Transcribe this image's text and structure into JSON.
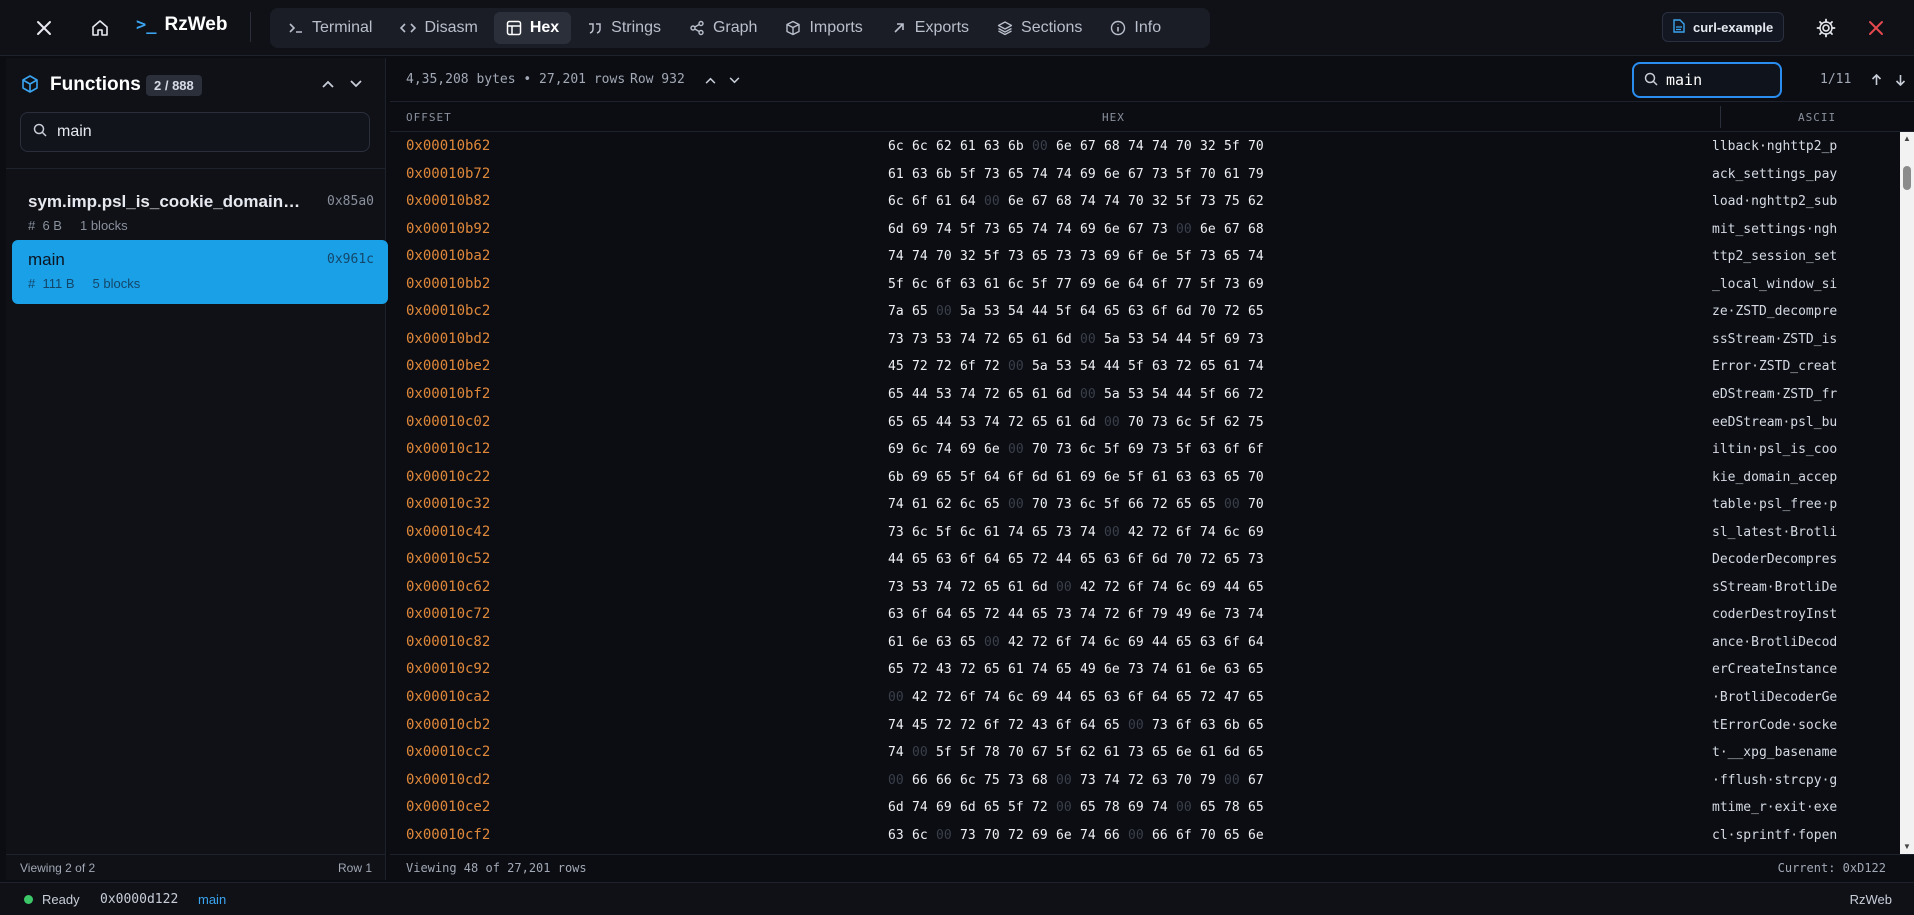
{
  "topbar": {
    "brand": "RzWeb",
    "brand_prompt": ">_",
    "tabs": [
      {
        "label": "Terminal",
        "icon": "terminal-icon",
        "active": false
      },
      {
        "label": "Disasm",
        "icon": "code-icon",
        "active": false
      },
      {
        "label": "Hex",
        "icon": "table-icon",
        "active": true
      },
      {
        "label": "Strings",
        "icon": "quote-icon",
        "active": false
      },
      {
        "label": "Graph",
        "icon": "share-icon",
        "active": false
      },
      {
        "label": "Imports",
        "icon": "package-icon",
        "active": false
      },
      {
        "label": "Exports",
        "icon": "arrow-up-right-icon",
        "active": false
      },
      {
        "label": "Sections",
        "icon": "layers-icon",
        "active": false
      },
      {
        "label": "Info",
        "icon": "info-icon",
        "active": false
      }
    ],
    "project": "curl-example"
  },
  "sidebar": {
    "title": "Functions",
    "count": "2 / 888",
    "search_value": "main",
    "items": [
      {
        "name": "sym.imp.psl_is_cookie_domain_acceptable",
        "addr": "0x85a0",
        "size": "6 B",
        "blocks": "1 blocks",
        "selected": false
      },
      {
        "name": "main",
        "addr": "0x961c",
        "size": "111 B",
        "blocks": "5 blocks",
        "selected": true
      }
    ],
    "footer_left": "Viewing 2 of 2",
    "footer_right": "Row 1"
  },
  "hex": {
    "stats": "4,35,208 bytes • 27,201 rows",
    "row_label": "Row 932",
    "search_value": "main",
    "match_count": "1/11",
    "columns": {
      "offset": "OFFSET",
      "hex": "HEX",
      "ascii": "ASCII"
    },
    "rows": [
      {
        "offset": "0x00010b62",
        "bytes": "6c 6c 62 61 63 6b 00 6e 67 68 74 74 70 32 5f 70",
        "ascii": "llback·nghttp2_p"
      },
      {
        "offset": "0x00010b72",
        "bytes": "61 63 6b 5f 73 65 74 74 69 6e 67 73 5f 70 61 79",
        "ascii": "ack_settings_pay"
      },
      {
        "offset": "0x00010b82",
        "bytes": "6c 6f 61 64 00 6e 67 68 74 74 70 32 5f 73 75 62",
        "ascii": "load·nghttp2_sub"
      },
      {
        "offset": "0x00010b92",
        "bytes": "6d 69 74 5f 73 65 74 74 69 6e 67 73 00 6e 67 68",
        "ascii": "mit_settings·ngh"
      },
      {
        "offset": "0x00010ba2",
        "bytes": "74 74 70 32 5f 73 65 73 73 69 6f 6e 5f 73 65 74",
        "ascii": "ttp2_session_set"
      },
      {
        "offset": "0x00010bb2",
        "bytes": "5f 6c 6f 63 61 6c 5f 77 69 6e 64 6f 77 5f 73 69",
        "ascii": "_local_window_si"
      },
      {
        "offset": "0x00010bc2",
        "bytes": "7a 65 00 5a 53 54 44 5f 64 65 63 6f 6d 70 72 65",
        "ascii": "ze·ZSTD_decompre"
      },
      {
        "offset": "0x00010bd2",
        "bytes": "73 73 53 74 72 65 61 6d 00 5a 53 54 44 5f 69 73",
        "ascii": "ssStream·ZSTD_is"
      },
      {
        "offset": "0x00010be2",
        "bytes": "45 72 72 6f 72 00 5a 53 54 44 5f 63 72 65 61 74",
        "ascii": "Error·ZSTD_creat"
      },
      {
        "offset": "0x00010bf2",
        "bytes": "65 44 53 74 72 65 61 6d 00 5a 53 54 44 5f 66 72",
        "ascii": "eDStream·ZSTD_fr"
      },
      {
        "offset": "0x00010c02",
        "bytes": "65 65 44 53 74 72 65 61 6d 00 70 73 6c 5f 62 75",
        "ascii": "eeDStream·psl_bu"
      },
      {
        "offset": "0x00010c12",
        "bytes": "69 6c 74 69 6e 00 70 73 6c 5f 69 73 5f 63 6f 6f",
        "ascii": "iltin·psl_is_coo"
      },
      {
        "offset": "0x00010c22",
        "bytes": "6b 69 65 5f 64 6f 6d 61 69 6e 5f 61 63 63 65 70",
        "ascii": "kie_domain_accep"
      },
      {
        "offset": "0x00010c32",
        "bytes": "74 61 62 6c 65 00 70 73 6c 5f 66 72 65 65 00 70",
        "ascii": "table·psl_free·p"
      },
      {
        "offset": "0x00010c42",
        "bytes": "73 6c 5f 6c 61 74 65 73 74 00 42 72 6f 74 6c 69",
        "ascii": "sl_latest·Brotli"
      },
      {
        "offset": "0x00010c52",
        "bytes": "44 65 63 6f 64 65 72 44 65 63 6f 6d 70 72 65 73",
        "ascii": "DecoderDecompres"
      },
      {
        "offset": "0x00010c62",
        "bytes": "73 53 74 72 65 61 6d 00 42 72 6f 74 6c 69 44 65",
        "ascii": "sStream·BrotliDe"
      },
      {
        "offset": "0x00010c72",
        "bytes": "63 6f 64 65 72 44 65 73 74 72 6f 79 49 6e 73 74",
        "ascii": "coderDestroyInst"
      },
      {
        "offset": "0x00010c82",
        "bytes": "61 6e 63 65 00 42 72 6f 74 6c 69 44 65 63 6f 64",
        "ascii": "ance·BrotliDecod"
      },
      {
        "offset": "0x00010c92",
        "bytes": "65 72 43 72 65 61 74 65 49 6e 73 74 61 6e 63 65",
        "ascii": "erCreateInstance"
      },
      {
        "offset": "0x00010ca2",
        "bytes": "00 42 72 6f 74 6c 69 44 65 63 6f 64 65 72 47 65",
        "ascii": "·BrotliDecoderGe"
      },
      {
        "offset": "0x00010cb2",
        "bytes": "74 45 72 72 6f 72 43 6f 64 65 00 73 6f 63 6b 65",
        "ascii": "tErrorCode·socke"
      },
      {
        "offset": "0x00010cc2",
        "bytes": "74 00 5f 5f 78 70 67 5f 62 61 73 65 6e 61 6d 65",
        "ascii": "t·__xpg_basename"
      },
      {
        "offset": "0x00010cd2",
        "bytes": "00 66 66 6c 75 73 68 00 73 74 72 63 70 79 00 67",
        "ascii": "·fflush·strcpy·g"
      },
      {
        "offset": "0x00010ce2",
        "bytes": "6d 74 69 6d 65 5f 72 00 65 78 69 74 00 65 78 65",
        "ascii": "mtime_r·exit·exe"
      },
      {
        "offset": "0x00010cf2",
        "bytes": "63 6c 00 73 70 72 69 6e 74 66 00 66 6f 70 65 6e",
        "ascii": "cl·sprintf·fopen"
      }
    ],
    "footer_viewing": "Viewing 48 of 27,201 rows",
    "footer_current": "Current: 0xD122"
  },
  "status": {
    "state": "Ready",
    "addr": "0x0000d122",
    "function": "main",
    "app": "RzWeb"
  },
  "colors": {
    "accent": "#1aa0e6",
    "offset": "#e0883a",
    "danger": "#e5484d",
    "ready": "#3cc768"
  }
}
